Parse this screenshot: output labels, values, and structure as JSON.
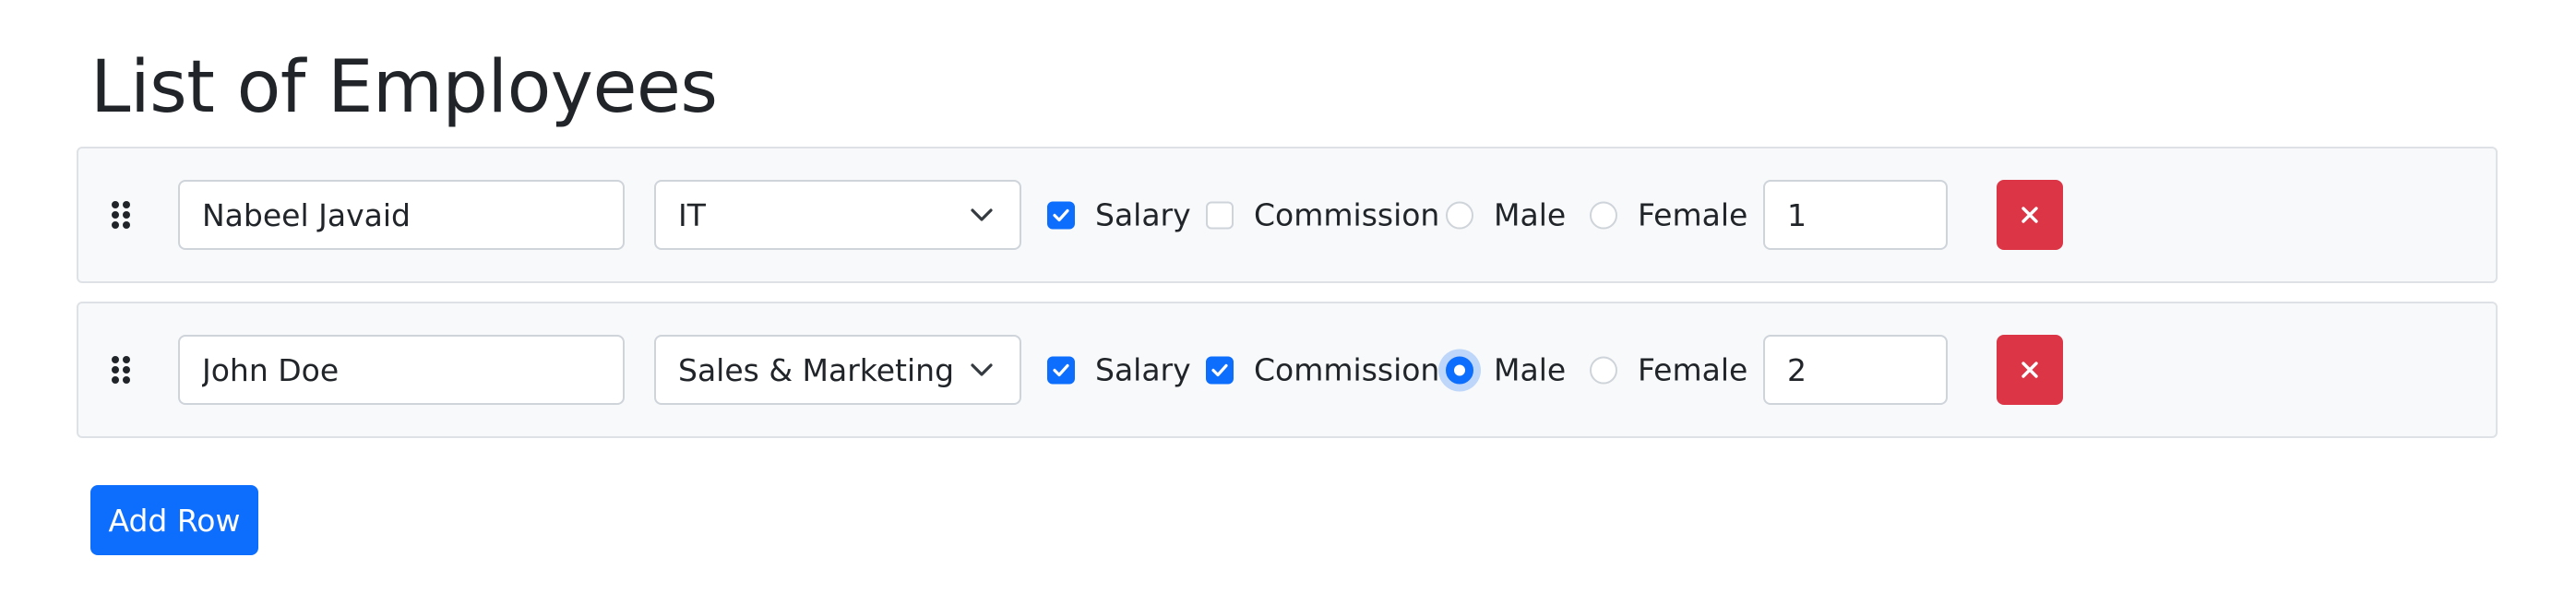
{
  "page": {
    "title": "List of Employees"
  },
  "rows": [
    {
      "name": "Nabeel Javaid",
      "department": "IT",
      "salary_label": "Salary",
      "salary_checked": true,
      "commission_label": "Commission",
      "commission_checked": false,
      "male_label": "Male",
      "female_label": "Female",
      "gender_selected": "",
      "order": "1"
    },
    {
      "name": "John Doe",
      "department": "Sales & Marketing",
      "salary_label": "Salary",
      "salary_checked": true,
      "commission_label": "Commission",
      "commission_checked": true,
      "male_label": "Male",
      "female_label": "Female",
      "gender_selected": "Male",
      "order": "2"
    }
  ],
  "actions": {
    "add_row_label": "Add Row"
  },
  "icons": {
    "drag": "grip-vertical-icon",
    "select": "chevron-down-icon",
    "delete": "close-icon",
    "check": "check-icon"
  },
  "colors": {
    "primary": "#0d6efd",
    "danger": "#dc3545",
    "row_background": "#f8f9fa",
    "row_border": "#dee2e6",
    "input_border": "#ced4da",
    "text": "#212529"
  }
}
